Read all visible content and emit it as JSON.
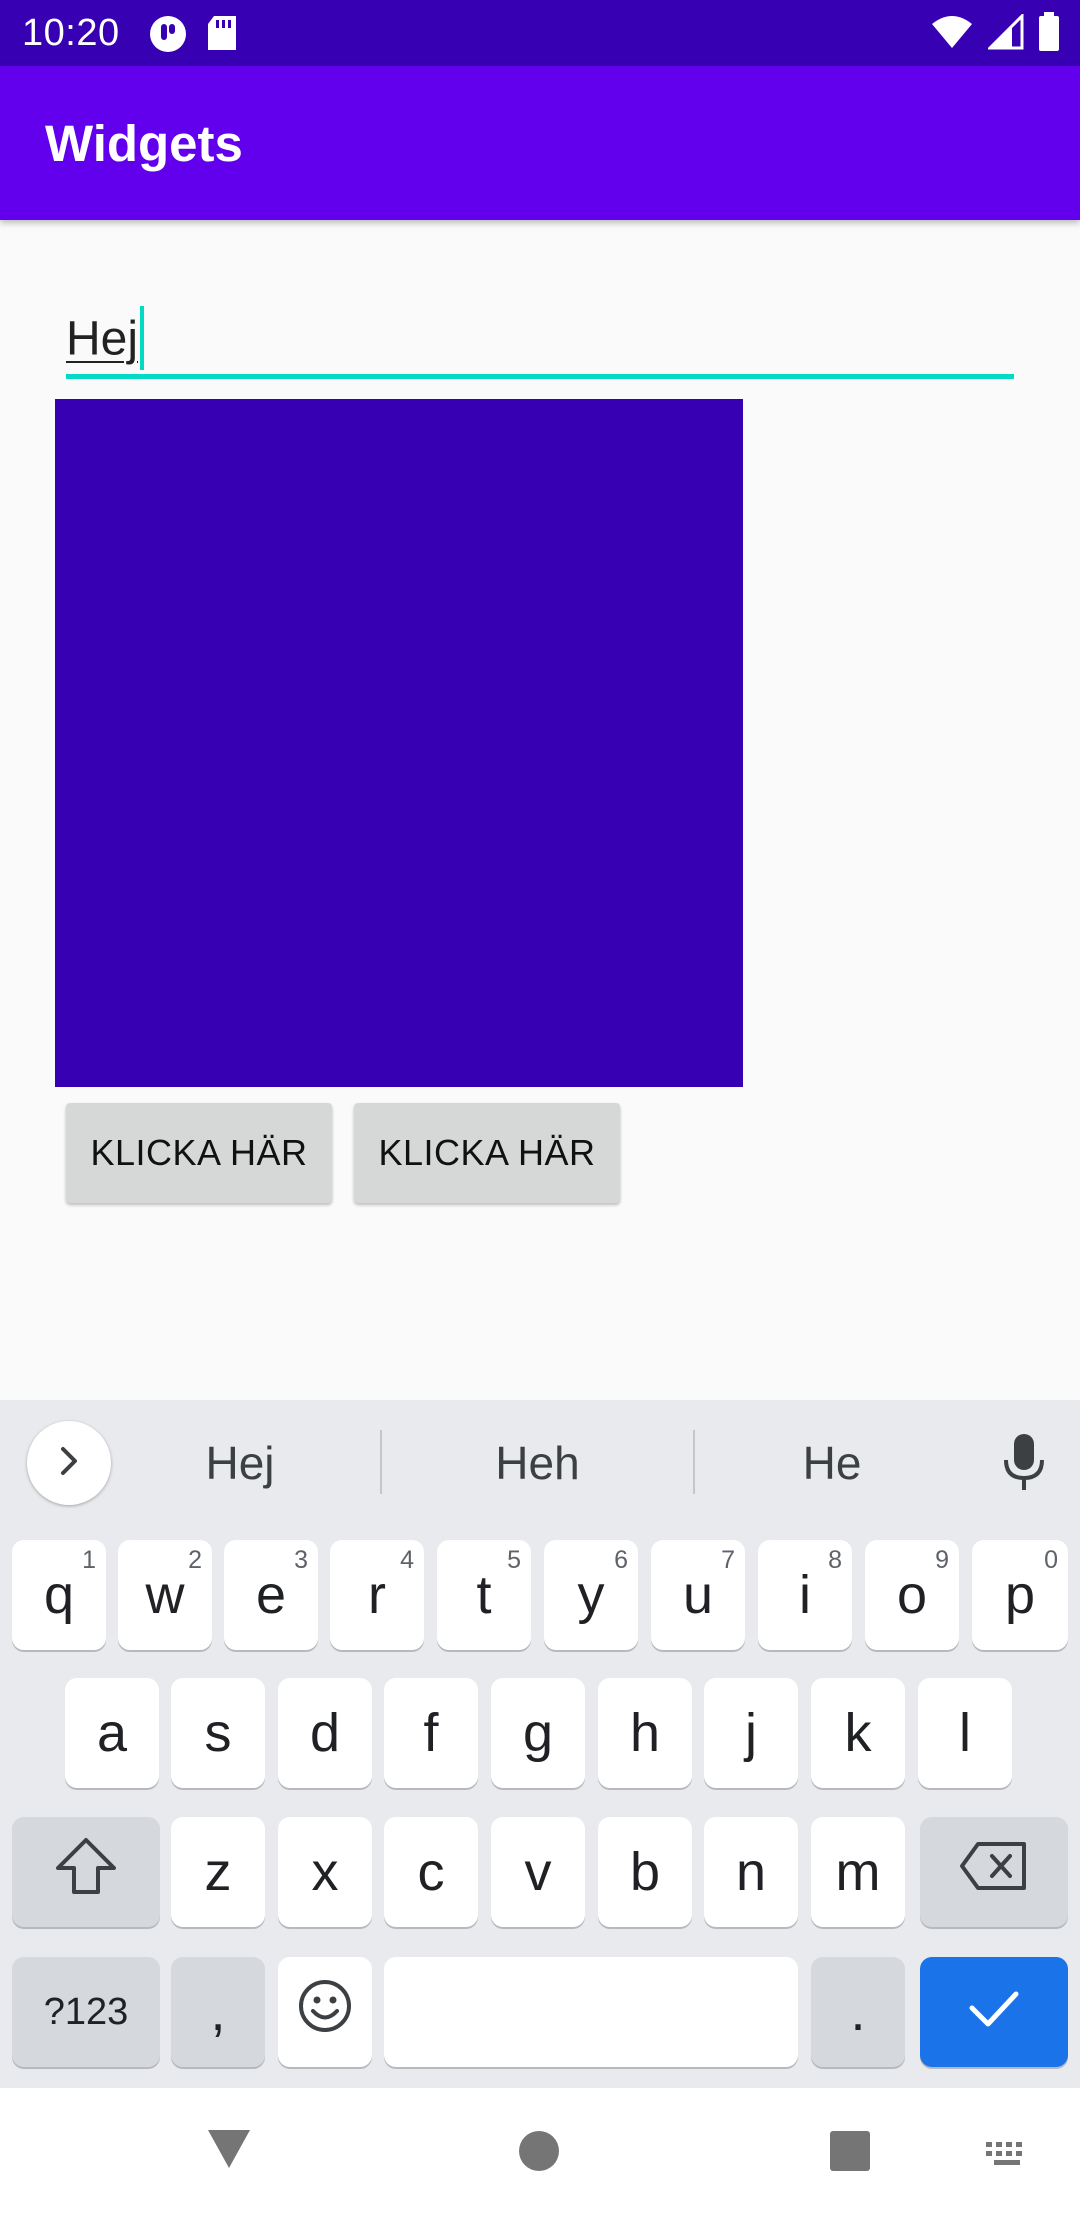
{
  "status_bar": {
    "time": "10:20",
    "icons_left": [
      "assistant-icon",
      "sd-card-icon"
    ],
    "icons_right": [
      "wifi-icon",
      "signal-icon",
      "battery-icon"
    ]
  },
  "app_bar": {
    "title": "Widgets"
  },
  "text_field": {
    "value": "Hej"
  },
  "buttons": [
    {
      "label": "KLICKA HÄR"
    },
    {
      "label": "KLICKA HÄR"
    }
  ],
  "colors": {
    "status_bar": "#3700b3",
    "app_bar": "#6200ee",
    "accent": "#03dac5",
    "box": "#3700b3",
    "enter_key": "#1a73e8"
  },
  "keyboard": {
    "suggestions": [
      "Hej",
      "Heh",
      "He"
    ],
    "row1": [
      {
        "key": "q",
        "hint": "1"
      },
      {
        "key": "w",
        "hint": "2"
      },
      {
        "key": "e",
        "hint": "3"
      },
      {
        "key": "r",
        "hint": "4"
      },
      {
        "key": "t",
        "hint": "5"
      },
      {
        "key": "y",
        "hint": "6"
      },
      {
        "key": "u",
        "hint": "7"
      },
      {
        "key": "i",
        "hint": "8"
      },
      {
        "key": "o",
        "hint": "9"
      },
      {
        "key": "p",
        "hint": "0"
      }
    ],
    "row2": [
      "a",
      "s",
      "d",
      "f",
      "g",
      "h",
      "j",
      "k",
      "l"
    ],
    "row3": [
      "z",
      "x",
      "c",
      "v",
      "b",
      "n",
      "m"
    ],
    "symbols_label": "?123",
    "comma": ",",
    "period": "."
  },
  "nav_bar": {
    "icons": [
      "back-icon",
      "home-icon",
      "recents-icon",
      "keyboard-switch-icon"
    ]
  }
}
